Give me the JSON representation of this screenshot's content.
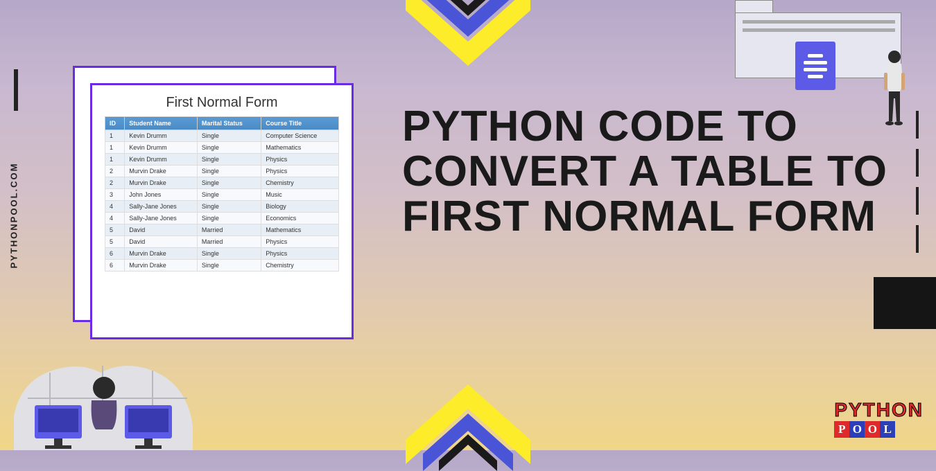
{
  "side_text": "PYTHONPOOL.COM",
  "main_title": "PYTHON CODE TO CONVERT A TABLE TO FIRST NORMAL FORM",
  "table_title": "First Normal Form",
  "headers": {
    "id": "ID",
    "name": "Student Name",
    "status": "Marital Status",
    "course": "Course Title"
  },
  "rows": [
    {
      "id": "1",
      "name": "Kevin Drumm",
      "status": "Single",
      "course": "Computer Science"
    },
    {
      "id": "1",
      "name": "Kevin Drumm",
      "status": "Single",
      "course": "Mathematics"
    },
    {
      "id": "1",
      "name": "Kevin Drumm",
      "status": "Single",
      "course": "Physics"
    },
    {
      "id": "2",
      "name": "Murvin Drake",
      "status": "Single",
      "course": "Physics"
    },
    {
      "id": "2",
      "name": "Murvin Drake",
      "status": "Single",
      "course": "Chemistry"
    },
    {
      "id": "3",
      "name": "John Jones",
      "status": "Single",
      "course": "Music"
    },
    {
      "id": "4",
      "name": "Sally-Jane Jones",
      "status": "Single",
      "course": "Biology"
    },
    {
      "id": "4",
      "name": "Sally-Jane Jones",
      "status": "Single",
      "course": "Economics"
    },
    {
      "id": "5",
      "name": "David",
      "status": "Married",
      "course": "Mathematics"
    },
    {
      "id": "5",
      "name": "David",
      "status": "Married",
      "course": "Physics"
    },
    {
      "id": "6",
      "name": "Murvin Drake",
      "status": "Single",
      "course": "Physics"
    },
    {
      "id": "6",
      "name": "Murvin Drake",
      "status": "Single",
      "course": "Chemistry"
    }
  ],
  "logo": {
    "top": "PYTHON",
    "bottom": [
      "P",
      "O",
      "O",
      "L"
    ]
  }
}
